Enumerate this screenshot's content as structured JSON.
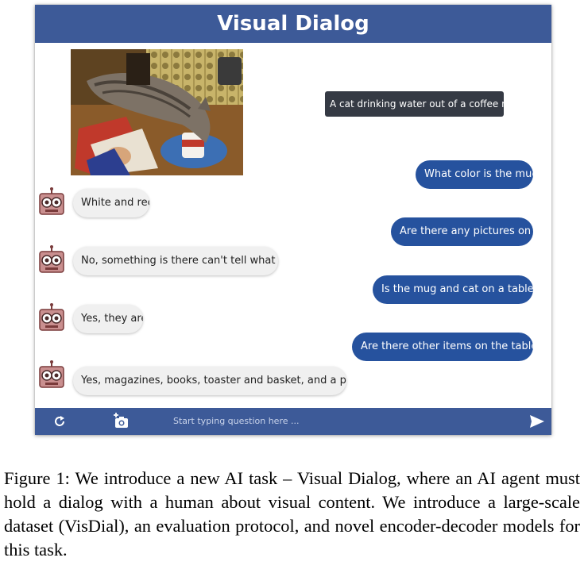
{
  "app": {
    "title": "Visual Dialog",
    "caption": "A cat drinking water out of a coffee mug."
  },
  "dialog": {
    "questions": [
      "What color is the mug?",
      "Are there any pictures on it?",
      "Is the mug and cat on a table?",
      "Are there other items on the table?"
    ],
    "answers": [
      "White and red",
      "No, something is there can't tell what it is",
      "Yes, they are",
      "Yes, magazines, books, toaster and basket, and a plate"
    ]
  },
  "footer": {
    "input_placeholder": "Start typing question here ..."
  },
  "figure": {
    "caption": "Figure 1: We introduce a new AI task – Visual Dialog, where an AI agent must hold a dialog with a human about visual content. We introduce a large-scale dataset (VisDial), an evaluation protocol, and novel encoder-decoder models for this task."
  },
  "colors": {
    "header": "#3d5a98",
    "question_bubble": "#26529e",
    "answer_bubble": "#f0f0f0",
    "caption_chip": "#353a44"
  },
  "icons": {
    "refresh": "refresh-icon",
    "camera": "add-photo-icon",
    "send": "send-icon",
    "bot": "robot-avatar-icon"
  }
}
